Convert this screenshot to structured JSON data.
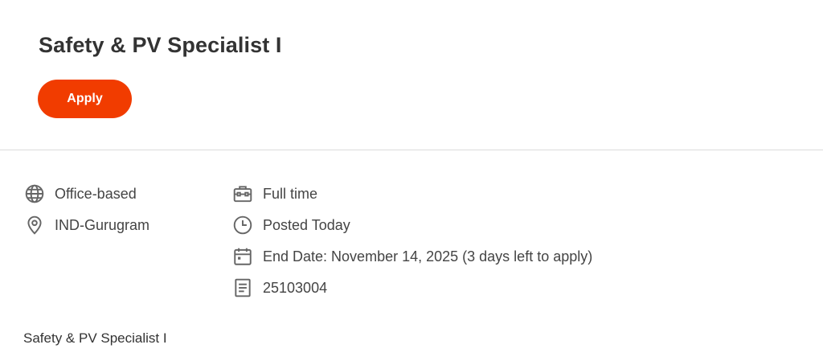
{
  "job": {
    "title": "Safety & PV Specialist I",
    "apply_label": "Apply"
  },
  "details": {
    "work_type": {
      "icon": "globe-icon",
      "label": "Office-based"
    },
    "location": {
      "icon": "location-pin-icon",
      "label": "IND-Gurugram"
    },
    "employment": {
      "icon": "briefcase-icon",
      "label": "Full time"
    },
    "posted": {
      "icon": "clock-icon",
      "label": "Posted Today"
    },
    "end_date": {
      "icon": "calendar-icon",
      "label": "End Date: November 14, 2025 (3 days left to apply)"
    },
    "requisition": {
      "icon": "document-icon",
      "label": "25103004"
    }
  },
  "description": {
    "text": "Safety & PV Specialist I"
  },
  "colors": {
    "accent": "#f13c00",
    "icon": "#666666",
    "text": "#333333",
    "divider": "#dcdcdc"
  }
}
